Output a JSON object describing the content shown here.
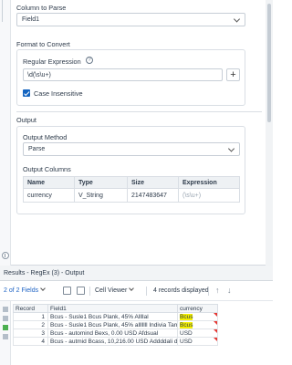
{
  "config": {
    "column_to_parse": {
      "label": "Column to Parse",
      "value": "Field1"
    },
    "format_to_convert": {
      "label": "Format to Convert",
      "regex_label": "Regular Expression",
      "regex_value": "\\d(\\s\\u+)",
      "help_icon_text": "?",
      "add_icon_text": "+",
      "case_insensitive_label": "Case Insensitive",
      "case_insensitive_checked": true
    },
    "output": {
      "label": "Output",
      "method_label": "Output Method",
      "method_value": "Parse",
      "columns_label": "Output Columns",
      "columns_headers": [
        "Name",
        "Type",
        "Size",
        "Expression"
      ],
      "columns_rows": [
        {
          "name": "currency",
          "type": "V_String",
          "size": "2147483647",
          "expression": "(\\s\\u+)"
        }
      ]
    }
  },
  "results": {
    "title": "Results - RegEx (3) - Output",
    "fields_label": "2 of 2 Fields",
    "cell_viewer_label": "Cell Viewer",
    "records_label": "4 records displayed",
    "headers": [
      "Record",
      "Field1",
      "currency"
    ],
    "rows": [
      {
        "record": "1",
        "field1": "Bcus - Susle1 Bcus  Plank, 45% Allllal",
        "currency": "Bcus",
        "highlight": true
      },
      {
        "record": "2",
        "field1": "Bcus - Susle1 Bcus  Plank, 45% alllllll Indivia Tarrrr",
        "currency": "Bcus",
        "highlight": true
      },
      {
        "record": "3",
        "field1": "Bcus - automind Bexs, 0.00 USD Afdsual",
        "currency": "USD",
        "highlight": false
      },
      {
        "record": "4",
        "field1": "Bcus - autmid Bcass, 10,216.00 USD Addddali dfd...",
        "currency": "USD",
        "highlight": false
      }
    ]
  },
  "colors": {
    "accent_blue": "#1565c0",
    "link_blue": "#1e63c4",
    "highlight_yellow": "#f4f000",
    "flag_red": "#e53935"
  },
  "icons": {
    "checkbox": "checkbox-checked-icon",
    "help": "help-circle-icon",
    "add": "plus-icon",
    "settings": "settings-icon",
    "delete": "delete-icon",
    "up": "arrow-up-icon",
    "down": "arrow-down-icon"
  }
}
